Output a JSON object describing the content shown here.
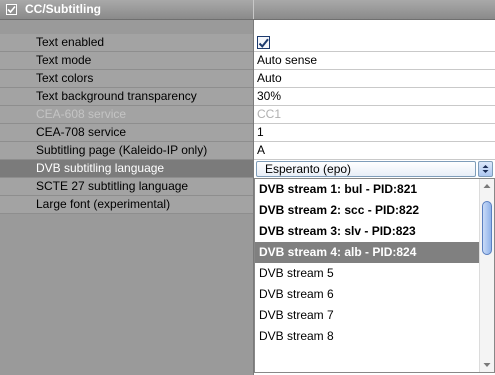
{
  "section": {
    "title": "CC/Subtitling"
  },
  "rows": [
    {
      "label": "Text enabled",
      "value": ""
    },
    {
      "label": "Text mode",
      "value": "Auto sense"
    },
    {
      "label": "Text colors",
      "value": "Auto"
    },
    {
      "label": "Text background transparency",
      "value": "30%"
    },
    {
      "label": "CEA-608 service",
      "value": "CC1"
    },
    {
      "label": "CEA-708 service",
      "value": "1"
    },
    {
      "label": "Subtitling page (Kaleido-IP only)",
      "value": "A"
    },
    {
      "label": "DVB subtitling language",
      "value": ""
    },
    {
      "label": "SCTE 27 subtitling language",
      "value": ""
    },
    {
      "label": "Large font (experimental)",
      "value": ""
    }
  ],
  "dropdown": {
    "selected": "Esperanto (epo)",
    "options": [
      "DVB stream 1: bul - PID:821",
      "DVB stream 2: scc - PID:822",
      "DVB stream 3: slv - PID:823",
      "DVB stream 4: alb - PID:824",
      "DVB stream 5",
      "DVB stream 6",
      "DVB stream 7",
      "DVB stream 8"
    ]
  },
  "text_enabled_checked": true,
  "colors": {
    "accent": "#1c3a6e",
    "highlight": "#808080",
    "header": "#8a8a8a"
  }
}
